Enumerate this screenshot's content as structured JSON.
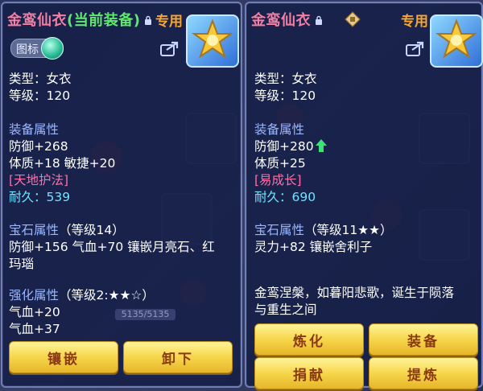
{
  "left_panel": {
    "title_name": "金鸾仙衣",
    "title_note": "(当前装备)",
    "special_label": "专用",
    "icon_toggle_label": "图标",
    "lines": {
      "type": "类型：女衣",
      "level": "等级：120",
      "equip_attr_header": "装备属性",
      "defense": "防御+268",
      "stats": "体质+18 敏捷+20",
      "special_skill": "[天地护法]",
      "durability": "耐久：539",
      "gem_header": "宝石属性",
      "gem_level": "（等级14）",
      "gem_line1": "防御+156 气血+70 镶嵌月亮石、红",
      "gem_line2": "玛瑙",
      "strength_header": "强化属性",
      "strength_level": "（等级2:★★☆）",
      "strength_line1": "气血+20",
      "strength_line2": "气血+37"
    },
    "buttons": {
      "inlay": "镶嵌",
      "unequip": "卸下"
    },
    "background_bar": "5135/5135"
  },
  "right_panel": {
    "title_name": "金鸾仙衣",
    "special_label": "专用",
    "lines": {
      "type": "类型：女衣",
      "level": "等级：120",
      "equip_attr_header": "装备属性",
      "defense": "防御+280",
      "stats": "体质+25",
      "special_skill": "[易成长]",
      "durability": "耐久：690",
      "gem_header": "宝石属性",
      "gem_level": "（等级11★★）",
      "gem_line1": "灵力+82 镶嵌舍利子",
      "desc_line1": "金鸾涅槃，如暮阳悲歌，诞生于陨落",
      "desc_line2": "与重生之间"
    },
    "buttons": {
      "refine": "炼化",
      "equip": "装备",
      "donate": "捐献",
      "extract": "提炼"
    }
  },
  "colors": {
    "title": "#f57fa3",
    "current_equip": "#5fe86c",
    "special": "#f5a531",
    "section": "#9ab6ff",
    "skill": "#ff6fa8",
    "durability": "#6ee3ff",
    "button": "#f6d64a",
    "button_text": "#8a3a12"
  },
  "icons": [
    "lock-icon",
    "share-icon",
    "equipment-badge-icon",
    "appraise-badge-icon",
    "up-arrow-icon"
  ]
}
